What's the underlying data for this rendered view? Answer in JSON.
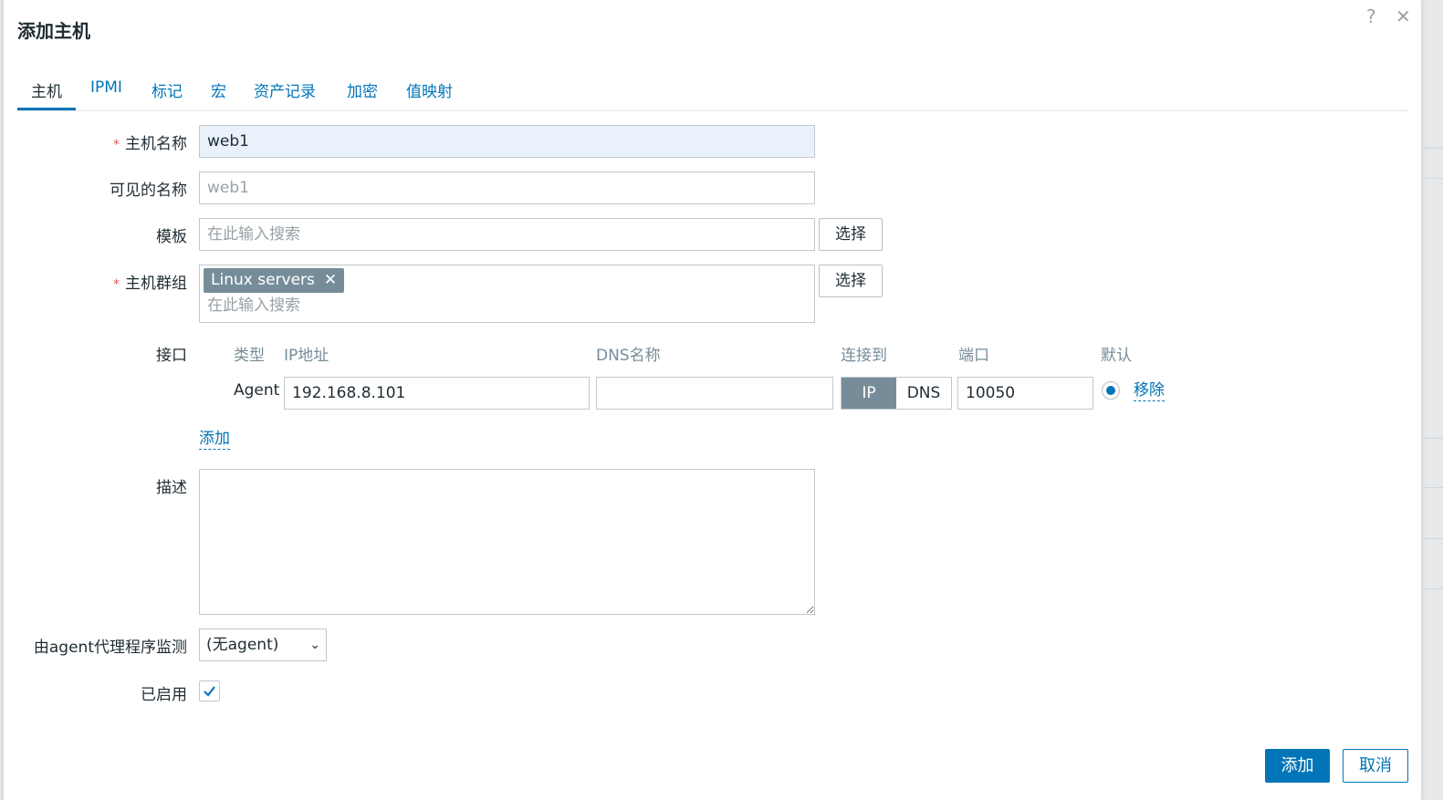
{
  "dialog": {
    "title": "添加主机",
    "help_icon": "?",
    "close_icon": "✕"
  },
  "tabs": [
    {
      "label": "主机",
      "active": true
    },
    {
      "label": "IPMI"
    },
    {
      "label": "标记"
    },
    {
      "label": "宏"
    },
    {
      "label": "资产记录"
    },
    {
      "label": "加密"
    },
    {
      "label": "值映射"
    }
  ],
  "form": {
    "host_name": {
      "label": "主机名称",
      "required_mark": "*",
      "value": "web1"
    },
    "visible_name": {
      "label": "可见的名称",
      "placeholder": "web1"
    },
    "templates": {
      "label": "模板",
      "placeholder": "在此输入搜索",
      "select_label": "选择"
    },
    "host_groups": {
      "label": "主机群组",
      "required_mark": "*",
      "chips": [
        "Linux servers"
      ],
      "chip_remove": "✕",
      "placeholder": "在此输入搜索",
      "select_label": "选择"
    },
    "interfaces": {
      "label": "接口",
      "headers": {
        "type": "类型",
        "ip": "IP地址",
        "dns": "DNS名称",
        "connect": "连接到",
        "port": "端口",
        "default": "默认"
      },
      "rows": [
        {
          "type": "Agent",
          "ip": "192.168.8.101",
          "dns": "",
          "connect_options": [
            "IP",
            "DNS"
          ],
          "connect_selected": "IP",
          "port": "10050",
          "remove_label": "移除"
        }
      ],
      "add_label": "添加"
    },
    "description": {
      "label": "描述",
      "value": ""
    },
    "monitored_by_proxy": {
      "label": "由agent代理程序监测",
      "selected": "(无agent)"
    },
    "enabled": {
      "label": "已启用",
      "checked": true
    }
  },
  "footer": {
    "add_label": "添加",
    "cancel_label": "取消"
  },
  "colors": {
    "accent": "#0275b8",
    "chip": "#768d99",
    "required": "#e45959"
  }
}
